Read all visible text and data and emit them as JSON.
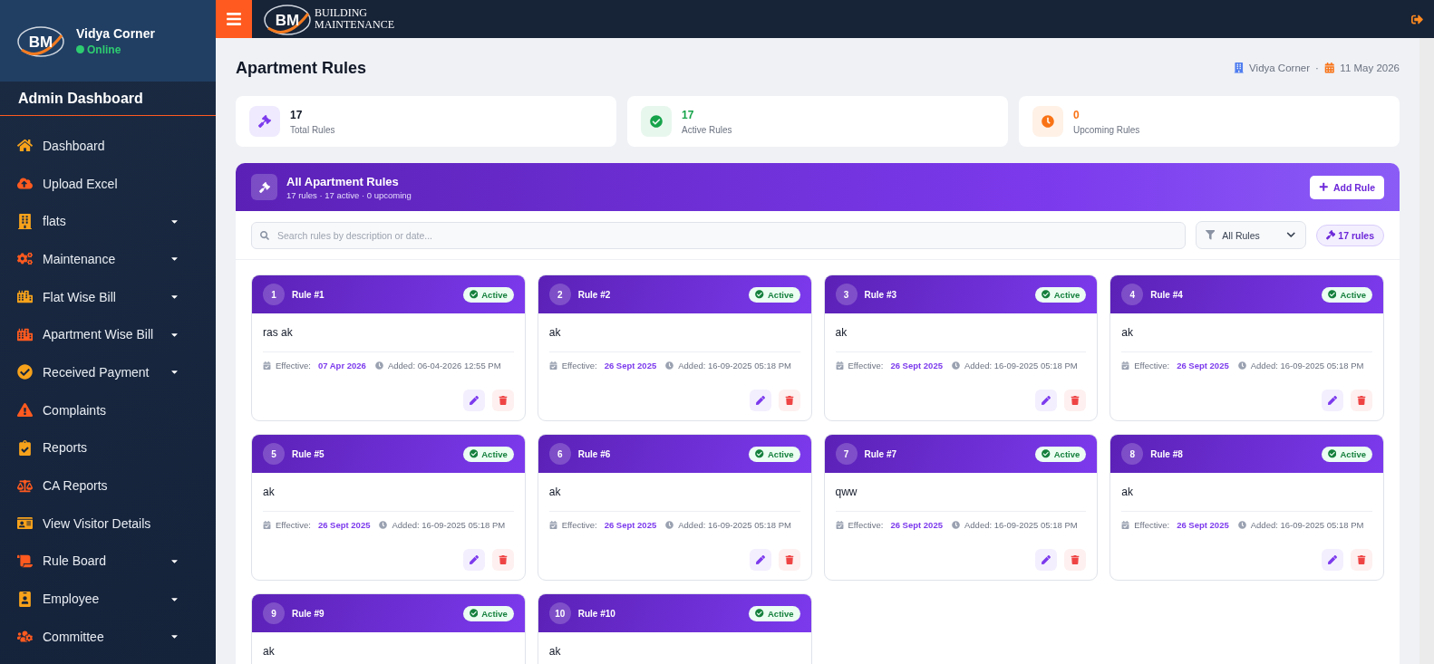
{
  "sidebar": {
    "logo": "BM",
    "user": "Vidya Corner",
    "status": "Online",
    "online": true,
    "section_title": "Admin Dashboard",
    "items": [
      {
        "label": "Dashboard",
        "expandable": false
      },
      {
        "label": "Upload Excel",
        "expandable": false
      },
      {
        "label": "flats",
        "expandable": true
      },
      {
        "label": "Maintenance",
        "expandable": true
      },
      {
        "label": "Flat Wise Bill",
        "expandable": true
      },
      {
        "label": "Apartment Wise Bill",
        "expandable": true
      },
      {
        "label": "Received Payment",
        "expandable": true
      },
      {
        "label": "Complaints",
        "expandable": false
      },
      {
        "label": "Reports",
        "expandable": false
      },
      {
        "label": "CA Reports",
        "expandable": false
      },
      {
        "label": "View Visitor Details",
        "expandable": false
      },
      {
        "label": "Rule Board",
        "expandable": true
      },
      {
        "label": "Employee",
        "expandable": true
      },
      {
        "label": "Committee",
        "expandable": true
      }
    ]
  },
  "topbar": {
    "logo": "BM",
    "brand_lines": [
      "BUILDING",
      "MAINTENANCE"
    ]
  },
  "page": {
    "title": "Apartment Rules",
    "building": "Vidya Corner",
    "separator": "·",
    "date": "11 May 2026"
  },
  "stats": [
    {
      "kind": "total",
      "value": "17",
      "label": "Total Rules"
    },
    {
      "kind": "active",
      "value": "17",
      "label": "Active Rules"
    },
    {
      "kind": "upcoming",
      "value": "0",
      "label": "Upcoming Rules"
    }
  ],
  "panel": {
    "title": "All Apartment Rules",
    "subtitle": "17 rules · 17 active · 0 upcoming",
    "add_button": "Add Rule",
    "search": {
      "placeholder": "Search rules by description or date..."
    },
    "filter": "All Rules",
    "count": "17 rules"
  },
  "rules": [
    {
      "number": "1",
      "title": "Rule #1",
      "status": "Active",
      "description": "ras ak",
      "effective_label": "Effective:",
      "effective": "07 Apr 2026",
      "added": "Added: 06-04-2026 12:55 PM"
    },
    {
      "number": "2",
      "title": "Rule #2",
      "status": "Active",
      "description": "ak",
      "effective_label": "Effective:",
      "effective": "26 Sept 2025",
      "added": "Added: 16-09-2025 05:18 PM"
    },
    {
      "number": "3",
      "title": "Rule #3",
      "status": "Active",
      "description": "ak",
      "effective_label": "Effective:",
      "effective": "26 Sept 2025",
      "added": "Added: 16-09-2025 05:18 PM"
    },
    {
      "number": "4",
      "title": "Rule #4",
      "status": "Active",
      "description": "ak",
      "effective_label": "Effective:",
      "effective": "26 Sept 2025",
      "added": "Added: 16-09-2025 05:18 PM"
    },
    {
      "number": "5",
      "title": "Rule #5",
      "status": "Active",
      "description": "ak",
      "effective_label": "Effective:",
      "effective": "26 Sept 2025",
      "added": "Added: 16-09-2025 05:18 PM"
    },
    {
      "number": "6",
      "title": "Rule #6",
      "status": "Active",
      "description": "ak",
      "effective_label": "Effective:",
      "effective": "26 Sept 2025",
      "added": "Added: 16-09-2025 05:18 PM"
    },
    {
      "number": "7",
      "title": "Rule #7",
      "status": "Active",
      "description": "qww",
      "effective_label": "Effective:",
      "effective": "26 Sept 2025",
      "added": "Added: 16-09-2025 05:18 PM"
    },
    {
      "number": "8",
      "title": "Rule #8",
      "status": "Active",
      "description": "ak",
      "effective_label": "Effective:",
      "effective": "26 Sept 2025",
      "added": "Added: 16-09-2025 05:18 PM"
    },
    {
      "number": "9",
      "title": "Rule #9",
      "status": "Active",
      "description": "ak"
    },
    {
      "number": "10",
      "title": "Rule #10",
      "status": "Active",
      "description": "ak"
    }
  ]
}
